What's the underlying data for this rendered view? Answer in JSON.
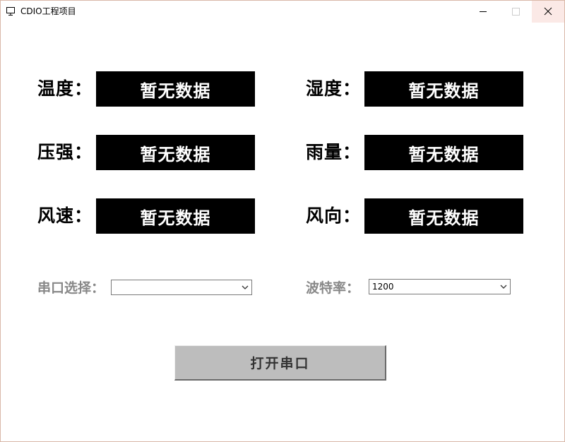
{
  "window": {
    "title": "CDIO工程项目",
    "icons": {
      "app": "monitor-icon",
      "minimize": "minimize-icon",
      "maximize": "maximize-icon",
      "close": "close-icon"
    }
  },
  "sensors": [
    {
      "label": "温度：",
      "value": "暂无数据"
    },
    {
      "label": "湿度：",
      "value": "暂无数据"
    },
    {
      "label": "压强：",
      "value": "暂无数据"
    },
    {
      "label": "雨量：",
      "value": "暂无数据"
    },
    {
      "label": "风速：",
      "value": "暂无数据"
    },
    {
      "label": "风向：",
      "value": "暂无数据"
    }
  ],
  "serial": {
    "port_label": "串口选择：",
    "port_value": "",
    "baud_label": "波特率：",
    "baud_value": "1200",
    "open_button": "打开串口"
  },
  "colors": {
    "data_box_bg": "#000000",
    "data_box_text": "#ffffff",
    "setting_label": "#888888",
    "button_bg": "#bdbdbd"
  }
}
